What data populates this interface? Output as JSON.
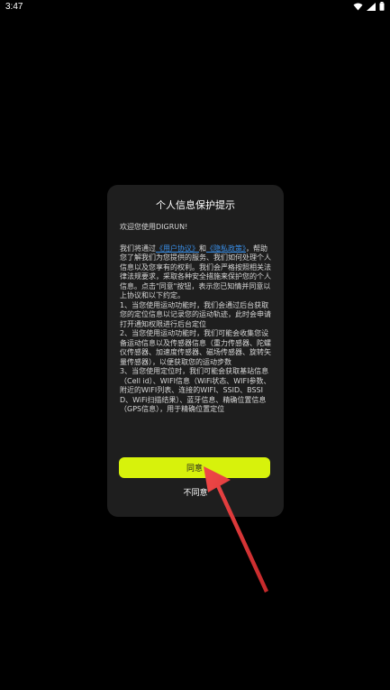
{
  "status_bar": {
    "time": "3:47"
  },
  "dialog": {
    "title": "个人信息保护提示",
    "greeting": "欢迎您使用DIGRUN!",
    "para1_prefix": "我们将通过",
    "link_user_agreement": "《用户协议》",
    "para1_and": "和",
    "link_privacy_policy": "《隐私政策》",
    "para1_rest": "，帮助您了解我们为您提供的服务、我们如何处理个人信息以及您享有的权利。我们会严格按照相关法律法规要求，采取各种安全措施来保护您的个人信息。点击\"同意\"按钮，表示您已知情并同意以上协议和以下约定。",
    "item1": "1、当您使用运动功能时，我们会通过后台获取您的定位信息以记录您的运动轨迹，此时会申请打开通知权限进行后台定位",
    "item2": "2、当您使用运动功能时，我们可能会收集您设备运动信息以及传感器信息（重力传感器、陀螺仪传感器、加速度传感器、磁场传感器、旋转矢量传感器），以便获取您的运动步数",
    "item3": "3、当您使用定位时，我们可能会获取基站信息（Cell id）、WIFI信息（WiFi状态、WIFI参数、附近的WIFI列表、连接的WIFI、SSID、BSSID、WiFi扫描结果）、蓝牙信息、精确位置信息（GPS信息），用于精确位置定位",
    "agree_label": "同意",
    "disagree_label": "不同意"
  },
  "colors": {
    "background": "#000000",
    "dialog_bg": "#1e1e1e",
    "accent": "#d7f20c",
    "link": "#3a8fe8",
    "arrow": "#e8383a"
  },
  "icons": [
    "wifi-icon",
    "signal-icon",
    "battery-icon"
  ]
}
